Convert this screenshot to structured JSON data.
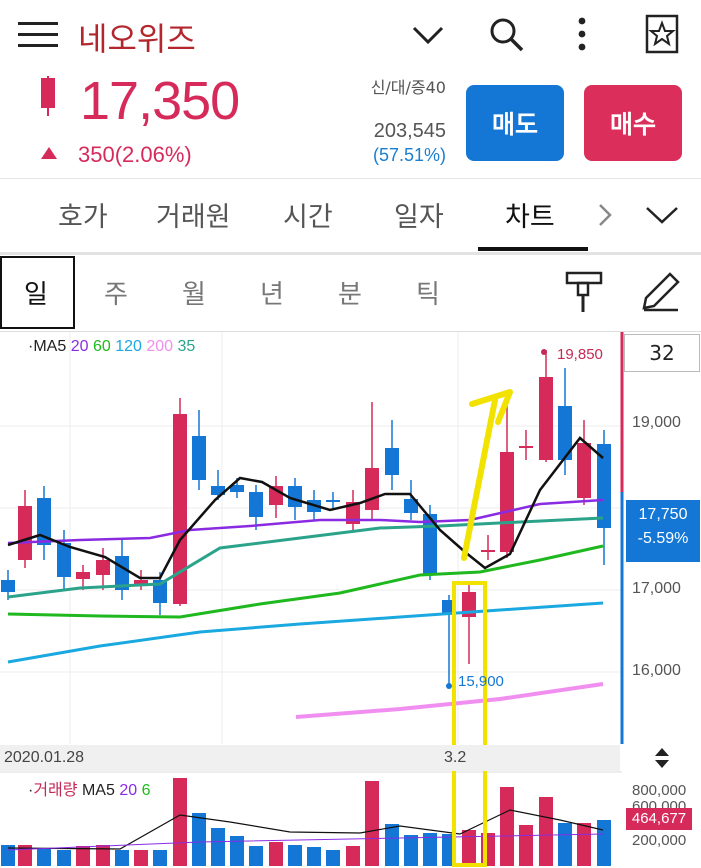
{
  "header": {
    "title": "네오위즈",
    "icons": [
      "menu-icon",
      "chevron-down-icon",
      "search-icon",
      "more-vert-icon",
      "star-bookmark-icon"
    ]
  },
  "quote": {
    "price": "17,350",
    "change": "350(2.06%)",
    "credit_info": "신/대/증40",
    "volume": "203,545",
    "turnover_ratio": "(57.51%)",
    "up_color": "#d62b5a",
    "down_color": "#1477d6"
  },
  "actions": {
    "sell": "매도",
    "buy": "매수"
  },
  "tabs": [
    "호가",
    "거래원",
    "시간",
    "일자",
    "차트"
  ],
  "active_tab": "차트",
  "periods": [
    "일",
    "주",
    "월",
    "년",
    "분",
    "틱"
  ],
  "active_period": "일",
  "chart": {
    "legend": {
      "prefix": "·MA5",
      "ma20": "20",
      "ma60": "60",
      "ma120": "120",
      "ma200": "200",
      "ma35": "35"
    },
    "count": "32",
    "y_labels": [
      "19,000",
      "17,000",
      "16,000"
    ],
    "high_label": "19,850",
    "low_label": "15,900",
    "current_price": "17,750",
    "current_pct": "-5.59%",
    "dates": {
      "start": "2020.01.28",
      "mid": "3.2"
    },
    "volume_legend": {
      "prefix": "·",
      "name": "거래량",
      "ma5": "MA5",
      "ma20": "20",
      "ma60": "6"
    },
    "volume_labels": [
      "800,000",
      "600,000",
      "200,000"
    ],
    "volume_current": "464,677"
  }
}
